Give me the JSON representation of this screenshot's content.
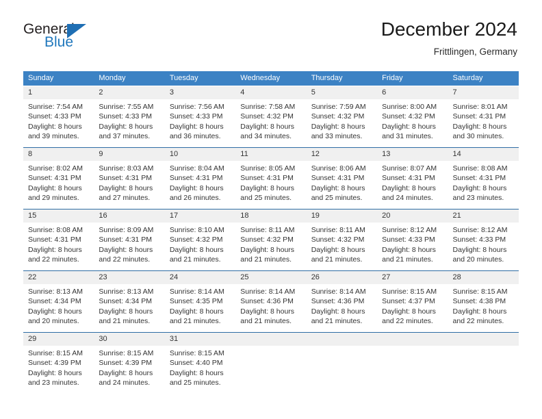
{
  "brand": {
    "word1": "General",
    "word2": "Blue",
    "logo_icon": "blue-triangle-icon",
    "color_dark": "#231f20",
    "color_blue": "#1f77bc"
  },
  "header": {
    "title": "December 2024",
    "subtitle": "Frittlingen, Germany"
  },
  "colors": {
    "header_band": "#3c82c4",
    "date_band": "#f0f0f0",
    "week_divider": "#2e6da4",
    "text": "#333333"
  },
  "weekdays": [
    "Sunday",
    "Monday",
    "Tuesday",
    "Wednesday",
    "Thursday",
    "Friday",
    "Saturday"
  ],
  "weeks": [
    {
      "days": [
        {
          "date": "1",
          "lines": [
            "Sunrise: 7:54 AM",
            "Sunset: 4:33 PM",
            "Daylight: 8 hours",
            "and 39 minutes."
          ]
        },
        {
          "date": "2",
          "lines": [
            "Sunrise: 7:55 AM",
            "Sunset: 4:33 PM",
            "Daylight: 8 hours",
            "and 37 minutes."
          ]
        },
        {
          "date": "3",
          "lines": [
            "Sunrise: 7:56 AM",
            "Sunset: 4:33 PM",
            "Daylight: 8 hours",
            "and 36 minutes."
          ]
        },
        {
          "date": "4",
          "lines": [
            "Sunrise: 7:58 AM",
            "Sunset: 4:32 PM",
            "Daylight: 8 hours",
            "and 34 minutes."
          ]
        },
        {
          "date": "5",
          "lines": [
            "Sunrise: 7:59 AM",
            "Sunset: 4:32 PM",
            "Daylight: 8 hours",
            "and 33 minutes."
          ]
        },
        {
          "date": "6",
          "lines": [
            "Sunrise: 8:00 AM",
            "Sunset: 4:32 PM",
            "Daylight: 8 hours",
            "and 31 minutes."
          ]
        },
        {
          "date": "7",
          "lines": [
            "Sunrise: 8:01 AM",
            "Sunset: 4:31 PM",
            "Daylight: 8 hours",
            "and 30 minutes."
          ]
        }
      ]
    },
    {
      "days": [
        {
          "date": "8",
          "lines": [
            "Sunrise: 8:02 AM",
            "Sunset: 4:31 PM",
            "Daylight: 8 hours",
            "and 29 minutes."
          ]
        },
        {
          "date": "9",
          "lines": [
            "Sunrise: 8:03 AM",
            "Sunset: 4:31 PM",
            "Daylight: 8 hours",
            "and 27 minutes."
          ]
        },
        {
          "date": "10",
          "lines": [
            "Sunrise: 8:04 AM",
            "Sunset: 4:31 PM",
            "Daylight: 8 hours",
            "and 26 minutes."
          ]
        },
        {
          "date": "11",
          "lines": [
            "Sunrise: 8:05 AM",
            "Sunset: 4:31 PM",
            "Daylight: 8 hours",
            "and 25 minutes."
          ]
        },
        {
          "date": "12",
          "lines": [
            "Sunrise: 8:06 AM",
            "Sunset: 4:31 PM",
            "Daylight: 8 hours",
            "and 25 minutes."
          ]
        },
        {
          "date": "13",
          "lines": [
            "Sunrise: 8:07 AM",
            "Sunset: 4:31 PM",
            "Daylight: 8 hours",
            "and 24 minutes."
          ]
        },
        {
          "date": "14",
          "lines": [
            "Sunrise: 8:08 AM",
            "Sunset: 4:31 PM",
            "Daylight: 8 hours",
            "and 23 minutes."
          ]
        }
      ]
    },
    {
      "days": [
        {
          "date": "15",
          "lines": [
            "Sunrise: 8:08 AM",
            "Sunset: 4:31 PM",
            "Daylight: 8 hours",
            "and 22 minutes."
          ]
        },
        {
          "date": "16",
          "lines": [
            "Sunrise: 8:09 AM",
            "Sunset: 4:31 PM",
            "Daylight: 8 hours",
            "and 22 minutes."
          ]
        },
        {
          "date": "17",
          "lines": [
            "Sunrise: 8:10 AM",
            "Sunset: 4:32 PM",
            "Daylight: 8 hours",
            "and 21 minutes."
          ]
        },
        {
          "date": "18",
          "lines": [
            "Sunrise: 8:11 AM",
            "Sunset: 4:32 PM",
            "Daylight: 8 hours",
            "and 21 minutes."
          ]
        },
        {
          "date": "19",
          "lines": [
            "Sunrise: 8:11 AM",
            "Sunset: 4:32 PM",
            "Daylight: 8 hours",
            "and 21 minutes."
          ]
        },
        {
          "date": "20",
          "lines": [
            "Sunrise: 8:12 AM",
            "Sunset: 4:33 PM",
            "Daylight: 8 hours",
            "and 21 minutes."
          ]
        },
        {
          "date": "21",
          "lines": [
            "Sunrise: 8:12 AM",
            "Sunset: 4:33 PM",
            "Daylight: 8 hours",
            "and 20 minutes."
          ]
        }
      ]
    },
    {
      "days": [
        {
          "date": "22",
          "lines": [
            "Sunrise: 8:13 AM",
            "Sunset: 4:34 PM",
            "Daylight: 8 hours",
            "and 20 minutes."
          ]
        },
        {
          "date": "23",
          "lines": [
            "Sunrise: 8:13 AM",
            "Sunset: 4:34 PM",
            "Daylight: 8 hours",
            "and 21 minutes."
          ]
        },
        {
          "date": "24",
          "lines": [
            "Sunrise: 8:14 AM",
            "Sunset: 4:35 PM",
            "Daylight: 8 hours",
            "and 21 minutes."
          ]
        },
        {
          "date": "25",
          "lines": [
            "Sunrise: 8:14 AM",
            "Sunset: 4:36 PM",
            "Daylight: 8 hours",
            "and 21 minutes."
          ]
        },
        {
          "date": "26",
          "lines": [
            "Sunrise: 8:14 AM",
            "Sunset: 4:36 PM",
            "Daylight: 8 hours",
            "and 21 minutes."
          ]
        },
        {
          "date": "27",
          "lines": [
            "Sunrise: 8:15 AM",
            "Sunset: 4:37 PM",
            "Daylight: 8 hours",
            "and 22 minutes."
          ]
        },
        {
          "date": "28",
          "lines": [
            "Sunrise: 8:15 AM",
            "Sunset: 4:38 PM",
            "Daylight: 8 hours",
            "and 22 minutes."
          ]
        }
      ]
    },
    {
      "days": [
        {
          "date": "29",
          "lines": [
            "Sunrise: 8:15 AM",
            "Sunset: 4:39 PM",
            "Daylight: 8 hours",
            "and 23 minutes."
          ]
        },
        {
          "date": "30",
          "lines": [
            "Sunrise: 8:15 AM",
            "Sunset: 4:39 PM",
            "Daylight: 8 hours",
            "and 24 minutes."
          ]
        },
        {
          "date": "31",
          "lines": [
            "Sunrise: 8:15 AM",
            "Sunset: 4:40 PM",
            "Daylight: 8 hours",
            "and 25 minutes."
          ]
        },
        {
          "date": "",
          "lines": []
        },
        {
          "date": "",
          "lines": []
        },
        {
          "date": "",
          "lines": []
        },
        {
          "date": "",
          "lines": []
        }
      ]
    }
  ]
}
